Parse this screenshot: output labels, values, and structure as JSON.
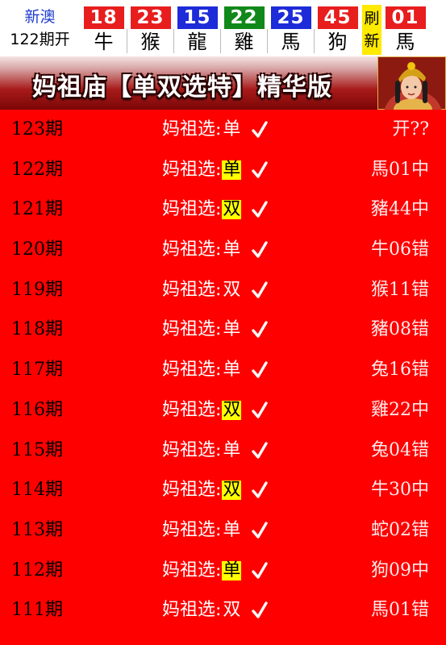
{
  "draw": {
    "region": "新澳",
    "issue": "122期开",
    "balls": [
      {
        "number": "18",
        "zodiac": "牛",
        "color": "#e81d1d"
      },
      {
        "number": "23",
        "zodiac": "猴",
        "color": "#e81d1d"
      },
      {
        "number": "15",
        "zodiac": "龍",
        "color": "#1d2bd8"
      },
      {
        "number": "22",
        "zodiac": "雞",
        "color": "#11891a"
      },
      {
        "number": "25",
        "zodiac": "馬",
        "color": "#1d2bd8"
      },
      {
        "number": "45",
        "zodiac": "狗",
        "color": "#e81d1d"
      }
    ],
    "special": {
      "number": "01",
      "zodiac": "馬",
      "color": "#e81d1d"
    },
    "refresh_line1": "刷",
    "refresh_line2": "新"
  },
  "banner": {
    "title": "妈祖庙【单双选特】精华版"
  },
  "rows_prefix": "妈祖选:",
  "rows": [
    {
      "issue": "123期",
      "value": "单",
      "highlight": false,
      "result": "开??"
    },
    {
      "issue": "122期",
      "value": "单",
      "highlight": true,
      "result": "馬01中"
    },
    {
      "issue": "121期",
      "value": "双",
      "highlight": true,
      "result": "豬44中"
    },
    {
      "issue": "120期",
      "value": "单",
      "highlight": false,
      "result": "牛06错"
    },
    {
      "issue": "119期",
      "value": "双",
      "highlight": false,
      "result": "猴11错"
    },
    {
      "issue": "118期",
      "value": "单",
      "highlight": false,
      "result": "豬08错"
    },
    {
      "issue": "117期",
      "value": "单",
      "highlight": false,
      "result": "兔16错"
    },
    {
      "issue": "116期",
      "value": "双",
      "highlight": true,
      "result": "雞22中"
    },
    {
      "issue": "115期",
      "value": "单",
      "highlight": false,
      "result": "兔04错"
    },
    {
      "issue": "114期",
      "value": "双",
      "highlight": true,
      "result": "牛30中"
    },
    {
      "issue": "113期",
      "value": "单",
      "highlight": false,
      "result": "蛇02错"
    },
    {
      "issue": "112期",
      "value": "单",
      "highlight": true,
      "result": "狗09中"
    },
    {
      "issue": "111期",
      "value": "双",
      "highlight": false,
      "result": "馬01错"
    }
  ]
}
